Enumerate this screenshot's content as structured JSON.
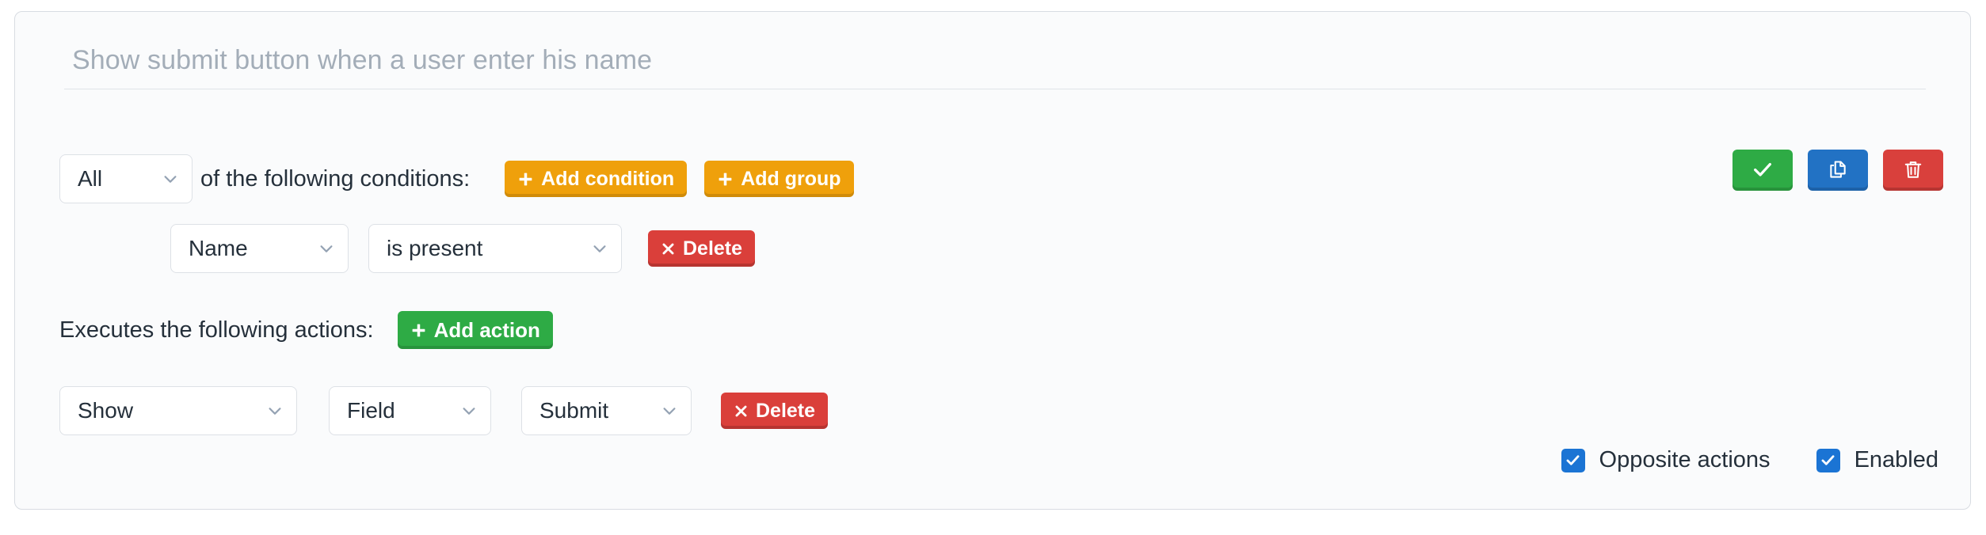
{
  "card": {
    "title_placeholder": "Show submit button when a user enter his name",
    "title_value": ""
  },
  "conditions": {
    "match_select": {
      "value": "All",
      "icon": "chevron-down-icon"
    },
    "match_text": "of the following conditions:",
    "add_condition_button": {
      "label": "Add condition",
      "icon": "plus-icon"
    },
    "add_group_button": {
      "label": "Add group",
      "icon": "plus-icon"
    },
    "rows": [
      {
        "field": "Name",
        "operator": "is present",
        "delete_label": "Delete",
        "delete_icon": "times-icon"
      }
    ]
  },
  "rule_tools": {
    "save_button": {
      "icon": "check-icon"
    },
    "duplicate_button": {
      "icon": "copy-icon"
    },
    "delete_button": {
      "icon": "trash-icon"
    }
  },
  "actions": {
    "heading": "Executes the following actions:",
    "add_action_button": {
      "label": "Add action",
      "icon": "plus-icon"
    },
    "rows": [
      {
        "verb": "Show",
        "target": "Field",
        "item": "Submit",
        "delete_label": "Delete",
        "delete_icon": "times-icon"
      }
    ]
  },
  "options": {
    "opposite_actions": {
      "label": "Opposite actions",
      "checked": true
    },
    "enabled": {
      "label": "Enabled",
      "checked": true
    }
  },
  "colors": {
    "orange": "#efa00b",
    "green": "#2eab45",
    "blue": "#2272c4",
    "red": "#d9403c",
    "checkbox_blue": "#1b74d4",
    "card_bg": "#fafbfc",
    "card_border": "#d8dce2",
    "text": "#25303b",
    "placeholder": "#a3adb8"
  }
}
